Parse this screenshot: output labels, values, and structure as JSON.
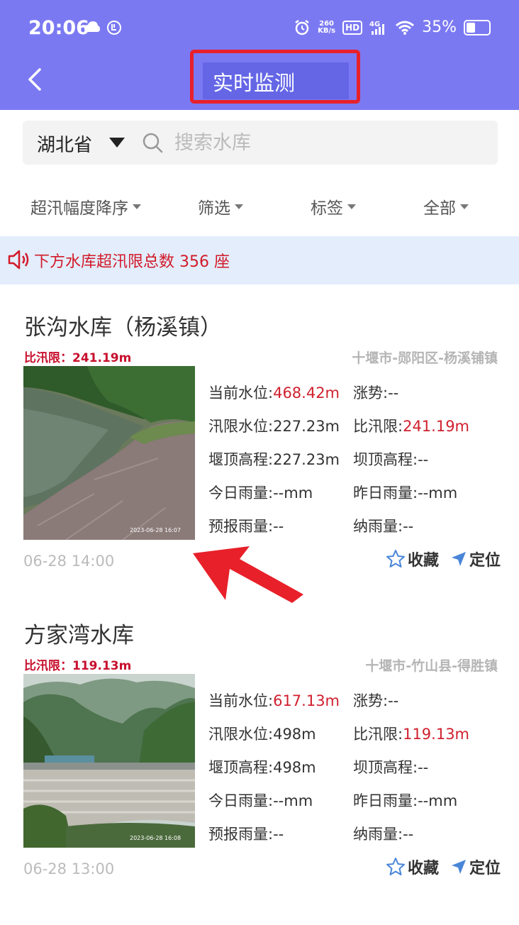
{
  "status": {
    "time": "20:06",
    "net_speed": "260",
    "net_unit": "KB/s",
    "hd": "HD",
    "network": "4G",
    "battery": "35%"
  },
  "header": {
    "title": "实时监测"
  },
  "search": {
    "province": "湖北省",
    "placeholder": "搜索水库"
  },
  "filters": [
    "超汛幅度降序",
    "筛选",
    "标签",
    "全部"
  ],
  "notice": "下方水库超汛限总数 356 座",
  "cards": [
    {
      "name": "张沟水库（杨溪镇）",
      "over_limit_label": "比汛限：241.19m",
      "region": "十堰市-郧阳区-杨溪铺镇",
      "photo_stamp": "2023-06-28 16:07",
      "metrics": [
        {
          "label": "当前水位:",
          "value": "468.42m",
          "red": true
        },
        {
          "label": "涨势:",
          "value": "--",
          "red": false
        },
        {
          "label": "汛限水位:",
          "value": "227.23m",
          "red": false
        },
        {
          "label": "比汛限:",
          "value": "241.19m",
          "red": true
        },
        {
          "label": "堰顶高程:",
          "value": "227.23m",
          "red": false
        },
        {
          "label": "坝顶高程:",
          "value": "--",
          "red": false
        },
        {
          "label": "今日雨量:",
          "value": "--mm",
          "red": false
        },
        {
          "label": "昨日雨量:",
          "value": "--mm",
          "red": false
        },
        {
          "label": "预报雨量:",
          "value": "--",
          "red": false
        },
        {
          "label": "纳雨量:",
          "value": "--",
          "red": false
        }
      ],
      "time": "06-28 14:00",
      "favorite": "收藏",
      "locate": "定位"
    },
    {
      "name": "方家湾水库",
      "over_limit_label": "比汛限：119.13m",
      "region": "十堰市-竹山县-得胜镇",
      "photo_stamp": "2023-06-28 16:08",
      "metrics": [
        {
          "label": "当前水位:",
          "value": "617.13m",
          "red": true
        },
        {
          "label": "涨势:",
          "value": "--",
          "red": false
        },
        {
          "label": "汛限水位:",
          "value": "498m",
          "red": false
        },
        {
          "label": "比汛限:",
          "value": "119.13m",
          "red": true
        },
        {
          "label": "堰顶高程:",
          "value": "498m",
          "red": false
        },
        {
          "label": "坝顶高程:",
          "value": "--",
          "red": false
        },
        {
          "label": "今日雨量:",
          "value": "--mm",
          "red": false
        },
        {
          "label": "昨日雨量:",
          "value": "--mm",
          "red": false
        },
        {
          "label": "预报雨量:",
          "value": "--",
          "red": false
        },
        {
          "label": "纳雨量:",
          "value": "--",
          "red": false
        }
      ],
      "time": "06-28 13:00",
      "favorite": "收藏",
      "locate": "定位"
    }
  ],
  "colors": {
    "header": "#7b79f2",
    "alert_red": "#d0202e",
    "notice_bg": "#e3edfb",
    "annotation_red": "#e8202a"
  }
}
